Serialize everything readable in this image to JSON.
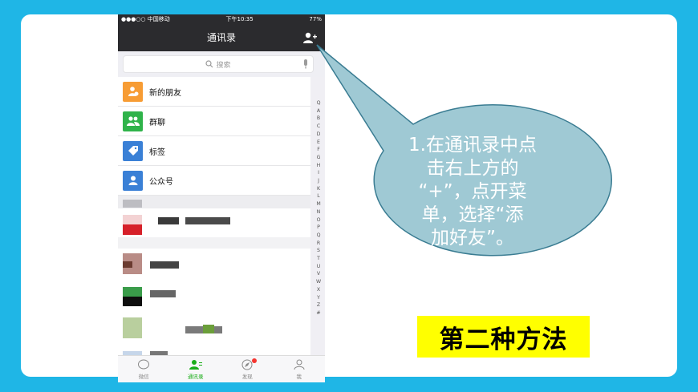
{
  "status_bar": {
    "carrier": "●●●○○ 中国移动",
    "time": "下午10:35",
    "battery": "77%"
  },
  "nav": {
    "title": "通讯录"
  },
  "search": {
    "placeholder": "搜索"
  },
  "contacts": {
    "special_items": [
      {
        "label": "新的朋友",
        "icon": "new-friend-icon",
        "color": "#f79c34"
      },
      {
        "label": "群聊",
        "icon": "group-chat-icon",
        "color": "#2fb34a"
      },
      {
        "label": "标签",
        "icon": "tag-icon",
        "color": "#3a80d6"
      },
      {
        "label": "公众号",
        "icon": "official-account-icon",
        "color": "#3a80d6"
      }
    ]
  },
  "index_letters": [
    "Q",
    "A",
    "B",
    "C",
    "D",
    "E",
    "F",
    "G",
    "H",
    "I",
    "J",
    "K",
    "L",
    "M",
    "N",
    "O",
    "P",
    "Q",
    "R",
    "S",
    "T",
    "U",
    "V",
    "W",
    "X",
    "Y",
    "Z",
    "#"
  ],
  "tabs": [
    {
      "label": "微信",
      "icon": "chat-icon"
    },
    {
      "label": "通讯录",
      "icon": "contacts-icon",
      "active": true
    },
    {
      "label": "发现",
      "icon": "compass-icon",
      "badge": true
    },
    {
      "label": "我",
      "icon": "me-icon"
    }
  ],
  "callout": {
    "text": "1.在通讯录中点\n击右上方的\n“+”，点开菜\n单，选择“添\n加好友”。",
    "fill": "#9fc9d4",
    "stroke": "#3a7c92"
  },
  "method_label": "第二种方法",
  "colors": {
    "background": "#1fb6e6",
    "highlight": "#ffff00",
    "wechat_green": "#1aad19"
  }
}
